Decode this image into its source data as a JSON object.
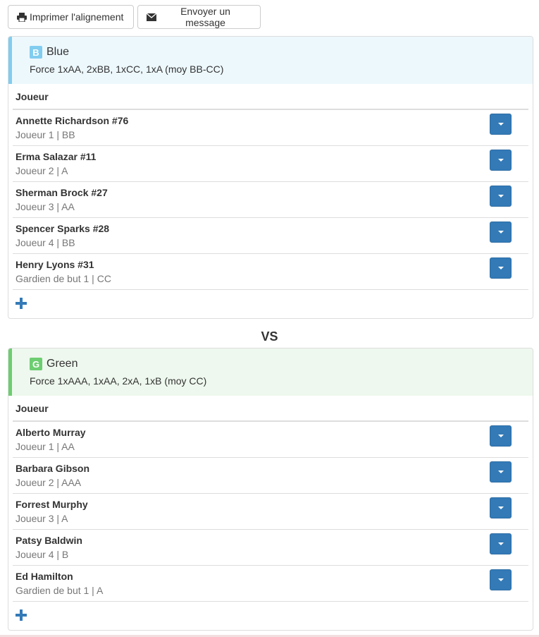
{
  "toolbar": {
    "print_label": "Imprimer l'alignement",
    "message_label": "Envoyer un message"
  },
  "vs_label": "VS",
  "teams": [
    {
      "badge": "B",
      "name": "Blue",
      "force": "Force 1xAA, 2xBB, 1xCC, 1xA (moy BB-CC)",
      "color": "#81cdf0",
      "column_header": "Joueur",
      "players": [
        {
          "name": "Annette Richardson #76",
          "info": "Joueur 1 | BB"
        },
        {
          "name": "Erma Salazar #11",
          "info": "Joueur 2 | A"
        },
        {
          "name": "Sherman Brock #27",
          "info": "Joueur 3 | AA"
        },
        {
          "name": "Spencer Sparks #28",
          "info": "Joueur 4 | BB"
        },
        {
          "name": "Henry Lyons #31",
          "info": "Gardien de but 1 | CC"
        }
      ]
    },
    {
      "badge": "G",
      "name": "Green",
      "force": "Force 1xAAA, 1xAA, 2xA, 1xB (moy CC)",
      "color": "#6dcd71",
      "column_header": "Joueur",
      "players": [
        {
          "name": "Alberto Murray",
          "info": "Joueur 1 | AA"
        },
        {
          "name": "Barbara Gibson",
          "info": "Joueur 2 | AAA"
        },
        {
          "name": "Forrest Murphy",
          "info": "Joueur 3 | A"
        },
        {
          "name": "Patsy Baldwin",
          "info": "Joueur 4 | B"
        },
        {
          "name": "Ed Hamilton",
          "info": "Gardien de but 1 | A"
        }
      ]
    }
  ],
  "icons": {
    "print": "print-icon",
    "message": "envelope-icon",
    "dropdown": "caret-down-icon",
    "add": "plus-icon"
  },
  "colors": {
    "primary": "#337ab7"
  }
}
